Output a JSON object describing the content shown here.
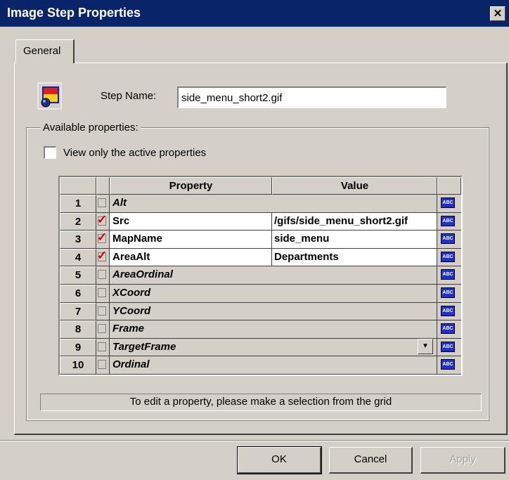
{
  "window": {
    "title": "Image Step Properties",
    "close_label": "✕"
  },
  "tabs": [
    {
      "label": "General"
    }
  ],
  "step": {
    "label": "Step Name:",
    "value": "side_menu_short2.gif"
  },
  "available": {
    "group_label": "Available properties:",
    "view_active_label": "View only the active properties",
    "view_active_checked": false
  },
  "grid": {
    "headers": {
      "property": "Property",
      "value": "Value"
    },
    "rows": [
      {
        "num": "1",
        "property": "Alt",
        "value": "",
        "active": false
      },
      {
        "num": "2",
        "property": "Src",
        "value": "/gifs/side_menu_short2.gif",
        "active": true
      },
      {
        "num": "3",
        "property": "MapName",
        "value": "side_menu",
        "active": true
      },
      {
        "num": "4",
        "property": "AreaAlt",
        "value": "Departments",
        "active": true
      },
      {
        "num": "5",
        "property": "AreaOrdinal",
        "value": "",
        "active": false
      },
      {
        "num": "6",
        "property": "XCoord",
        "value": "",
        "active": false
      },
      {
        "num": "7",
        "property": "YCoord",
        "value": "",
        "active": false
      },
      {
        "num": "8",
        "property": "Frame",
        "value": "",
        "active": false
      },
      {
        "num": "9",
        "property": "TargetFrame",
        "value": "",
        "active": false,
        "dropdown": true
      },
      {
        "num": "10",
        "property": "Ordinal",
        "value": "",
        "active": false
      }
    ],
    "check_glyph": "✓",
    "abc_label": "ABC"
  },
  "status_text": "To edit a property, please make a selection from the grid",
  "buttons": {
    "ok": "OK",
    "cancel": "Cancel",
    "apply": "Apply"
  },
  "colors": {
    "title_bar": "#0a246a",
    "dialog_bg": "#d4d0c8",
    "abc_icon": "#2030d0",
    "check_mark": "#d00000"
  }
}
